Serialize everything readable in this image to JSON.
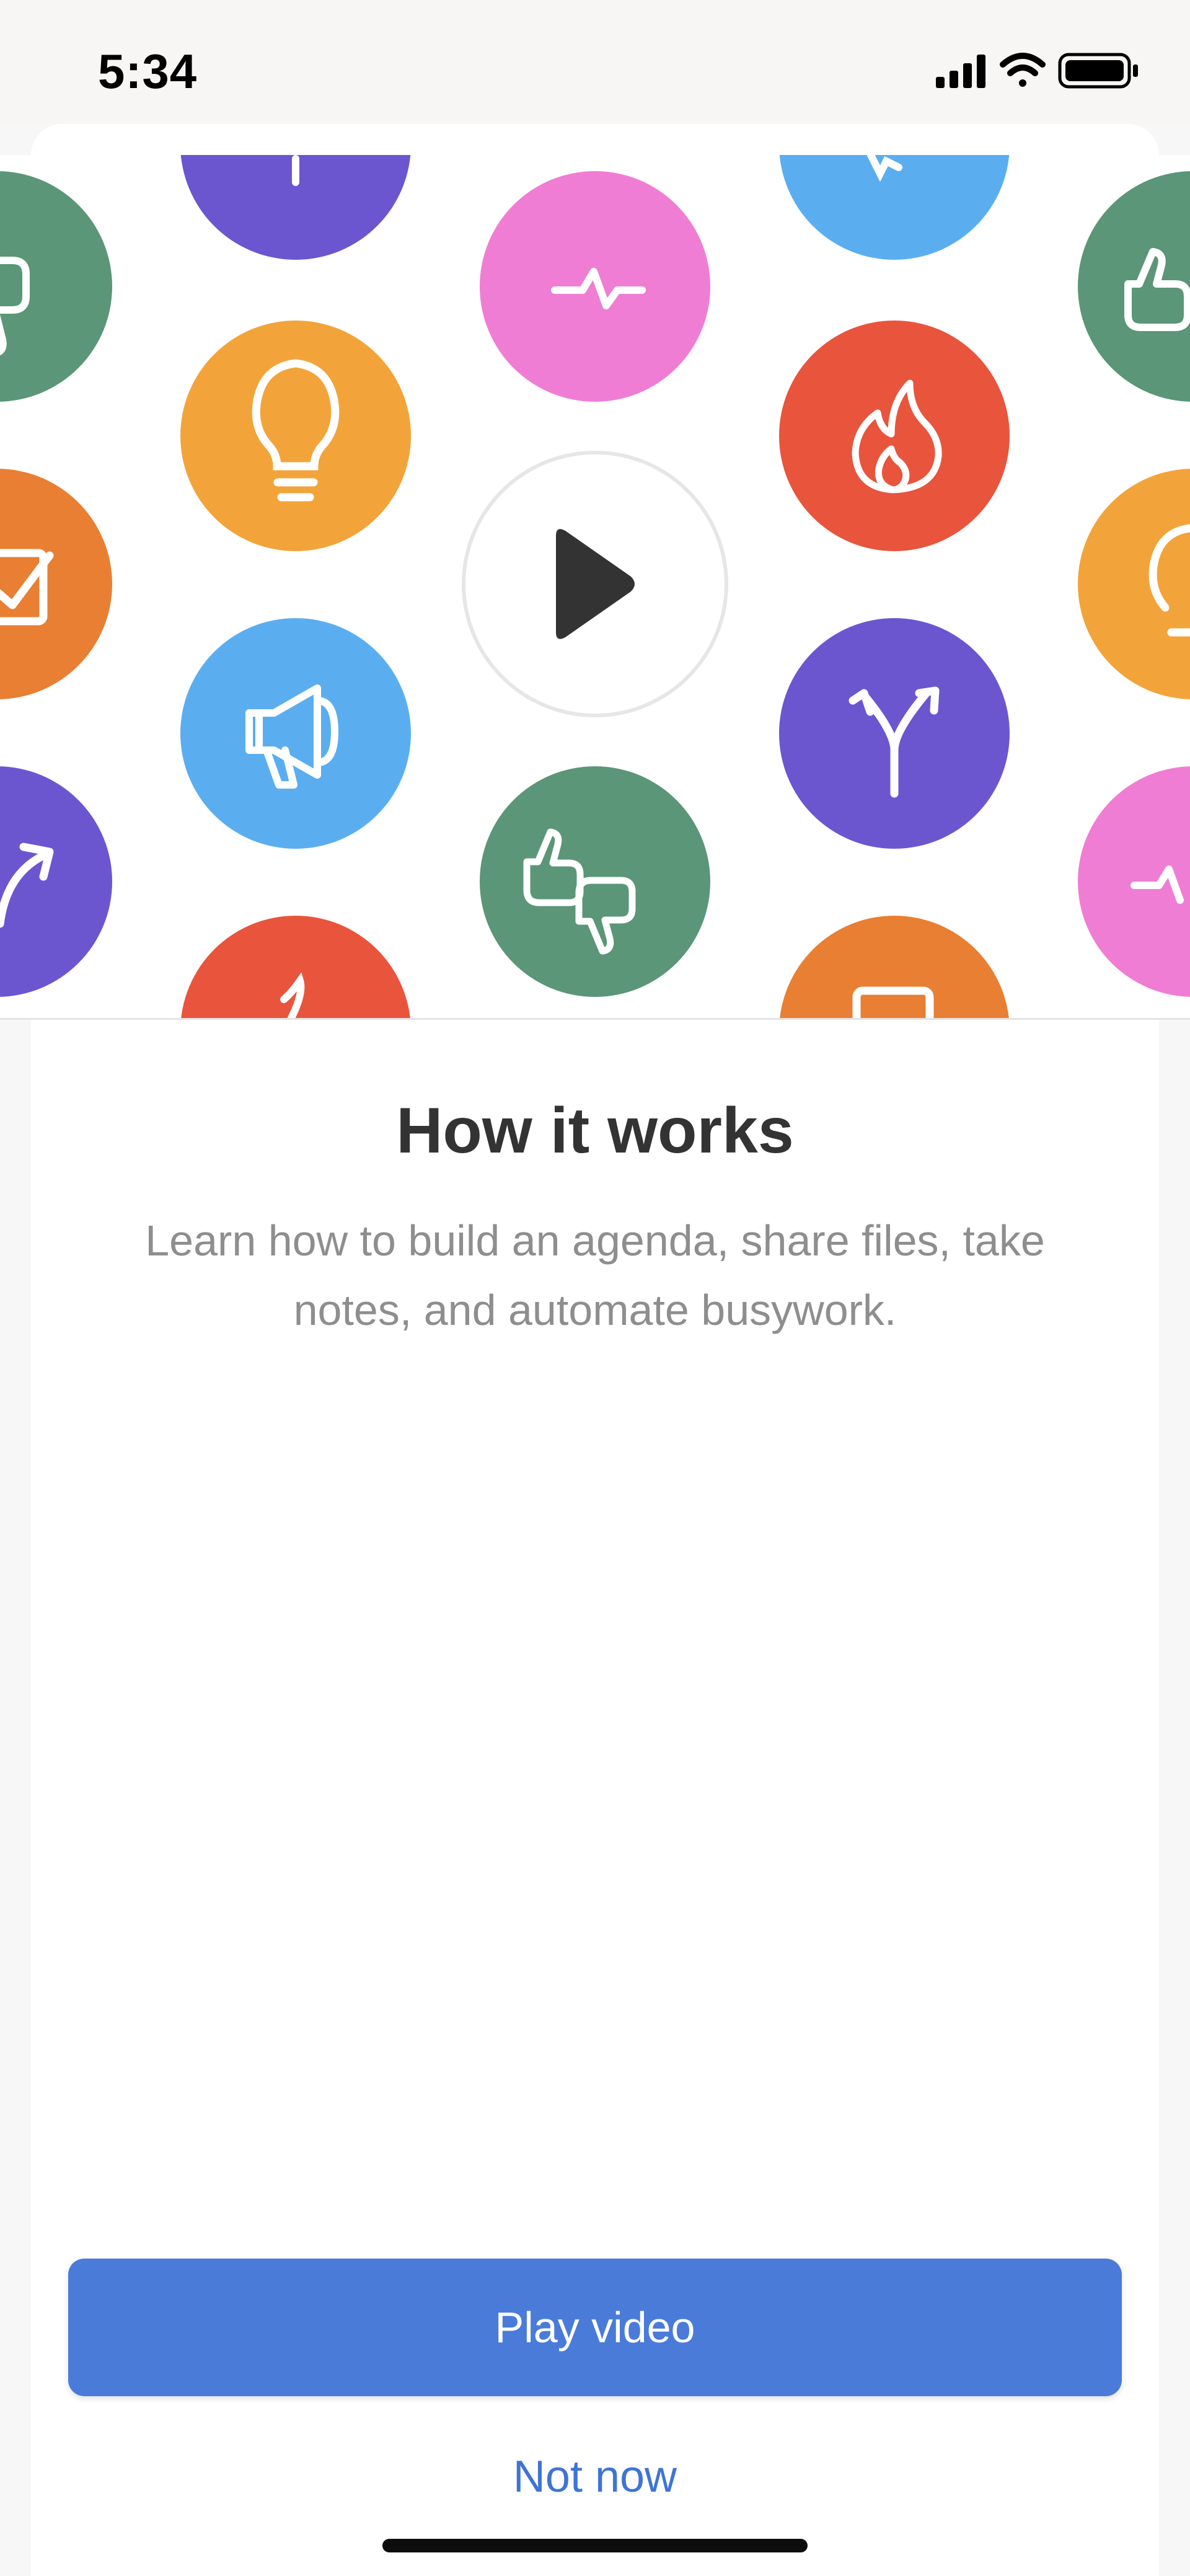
{
  "status_bar": {
    "time": "5:34",
    "icons": [
      "cellular-signal-icon",
      "wifi-icon",
      "battery-icon"
    ]
  },
  "hero": {
    "play_icon": "play-icon",
    "tiles": [
      {
        "icon": "thumbs-down-icon",
        "color": "#5a9677"
      },
      {
        "icon": "pulse-icon",
        "color": "#f07dd4"
      },
      {
        "icon": "thumbs-up-icon",
        "color": "#5a9677"
      },
      {
        "icon": "lightbulb-icon",
        "color": "#f2a43a"
      },
      {
        "icon": "flame-icon",
        "color": "#e9543c"
      },
      {
        "icon": "checkbox-icon",
        "color": "#e87f33"
      },
      {
        "icon": "megaphone-icon",
        "color": "#5aaef0"
      },
      {
        "icon": "split-arrows-icon",
        "color": "#6b56d0"
      },
      {
        "icon": "trend-arrow-icon",
        "color": "#6b56d0"
      },
      {
        "icon": "thumbs-up-down-icon",
        "color": "#5a9677"
      }
    ]
  },
  "content": {
    "title": "How it works",
    "description": "Learn how to build an agenda, share files, take notes, and automate busywork."
  },
  "actions": {
    "primary_label": "Play video",
    "secondary_label": "Not now",
    "primary_color": "#4a7bd9",
    "secondary_color": "#3f74d6"
  }
}
